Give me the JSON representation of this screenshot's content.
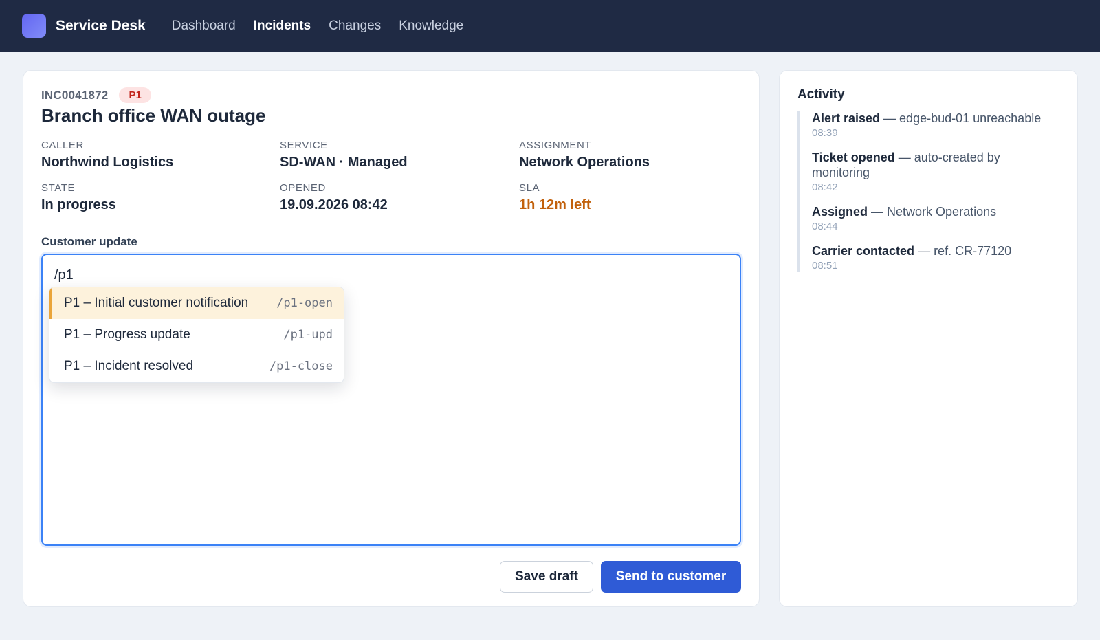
{
  "app": {
    "name": "Service Desk"
  },
  "nav": [
    {
      "label": "Dashboard",
      "active": false
    },
    {
      "label": "Incidents",
      "active": true
    },
    {
      "label": "Changes",
      "active": false
    },
    {
      "label": "Knowledge",
      "active": false
    }
  ],
  "ticket": {
    "id": "INC0041872",
    "priority": "P1",
    "title": "Branch office WAN outage",
    "fields": {
      "caller": {
        "label": "CALLER",
        "value": "Northwind Logistics"
      },
      "service": {
        "label": "SERVICE",
        "value": "SD-WAN · Managed"
      },
      "assignment": {
        "label": "ASSIGNMENT",
        "value": "Network Operations"
      },
      "state": {
        "label": "STATE",
        "value": "In progress"
      },
      "opened": {
        "label": "OPENED",
        "value": "19.09.2026 08:42"
      },
      "sla": {
        "label": "SLA",
        "value": "1h 12m left"
      }
    }
  },
  "colors": {
    "sla_warning": "#c2610c",
    "priority_bg": "#fde3e3",
    "priority_text": "#c2261e",
    "primary": "#2f5bd6",
    "highlight": "#fdf2dc",
    "highlight_border": "#eaa53a"
  },
  "editor": {
    "label": "Customer update",
    "value": "/p1",
    "suggestions": [
      {
        "label": "P1 – Initial customer notification",
        "code": "/p1-open",
        "selected": true
      },
      {
        "label": "P1 – Progress update",
        "code": "/p1-upd",
        "selected": false
      },
      {
        "label": "P1 – Incident resolved",
        "code": "/p1-close",
        "selected": false
      }
    ]
  },
  "actions": {
    "save_draft": "Save draft",
    "send": "Send to customer"
  },
  "activity": {
    "title": "Activity",
    "events": [
      {
        "title": "Alert raised",
        "detail": " — edge-bud-01 unreachable",
        "time": "08:39"
      },
      {
        "title": "Ticket opened",
        "detail": " — auto-created by monitoring",
        "time": "08:42"
      },
      {
        "title": "Assigned",
        "detail": " — Network Operations",
        "time": "08:44"
      },
      {
        "title": "Carrier contacted",
        "detail": " — ref. CR-77120",
        "time": "08:51"
      }
    ]
  }
}
